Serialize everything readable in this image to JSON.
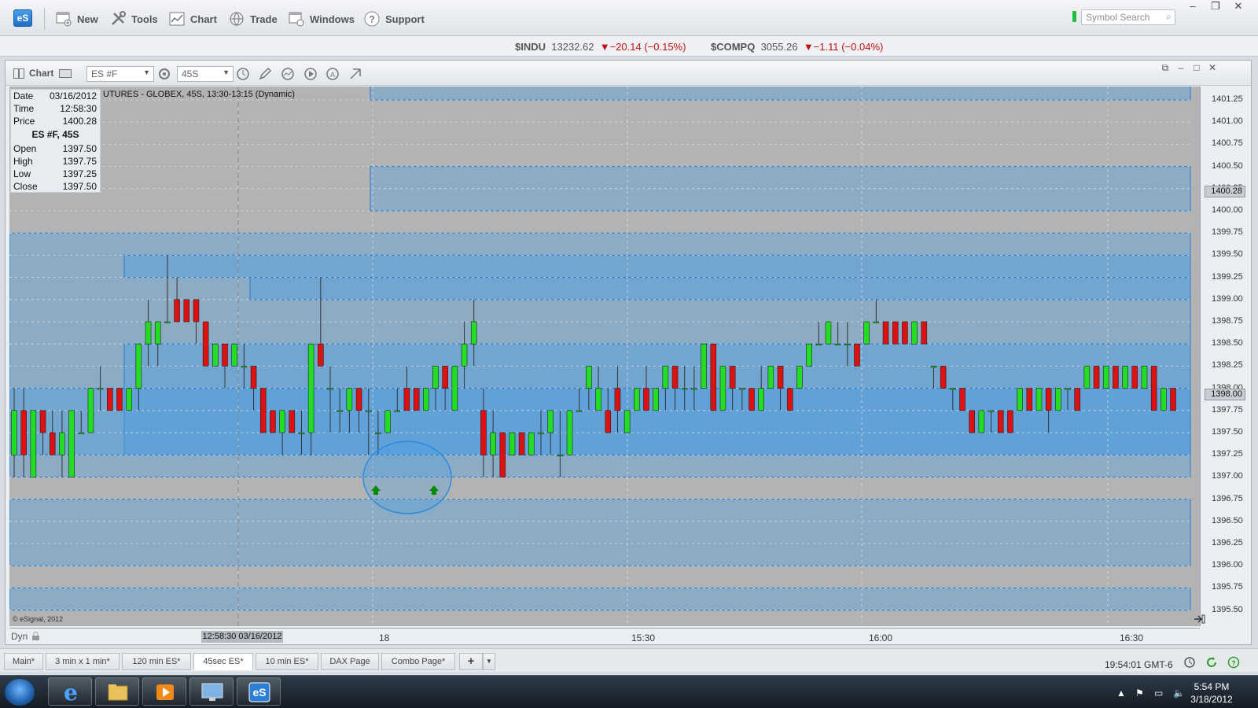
{
  "toolbar": {
    "logo": "eS",
    "buttons": [
      "New",
      "Tools",
      "Chart",
      "Trade",
      "Windows",
      "Support"
    ],
    "search_placeholder": "Symbol Search"
  },
  "tickers": [
    {
      "symbol": "$INDU",
      "last": "13232.62",
      "change": "▼−20.14 (−0.15%)"
    },
    {
      "symbol": "$COMPQ",
      "last": "3055.26",
      "change": "▼−1.11 (−0.04%)"
    }
  ],
  "chart_toolbar": {
    "title": "Chart",
    "symbol": "ES #F",
    "interval": "45S"
  },
  "info_box": {
    "date_label": "Date",
    "date": "03/16/2012",
    "time_label": "Time",
    "time": "12:58:30",
    "price_label": "Price",
    "price": "1400.28",
    "header": "ES #F, 45S",
    "open_label": "Open",
    "open": "1397.50",
    "high_label": "High",
    "high": "1397.75",
    "low_label": "Low",
    "low": "1397.25",
    "close_label": "Close",
    "close": "1397.50"
  },
  "chart_caption": "UTURES - GLOBEX, 45S, 13:30-13:15 (Dynamic)",
  "copyright": "© eSignal, 2012",
  "chart_data": {
    "type": "candlestick",
    "price_axis": [
      "1401.25",
      "1401.00",
      "1400.75",
      "1400.50",
      "1400.25",
      "1400.00",
      "1399.75",
      "1399.50",
      "1399.25",
      "1399.00",
      "1398.75",
      "1398.50",
      "1398.25",
      "1398.00",
      "1397.75",
      "1397.50",
      "1397.25",
      "1397.00",
      "1396.75",
      "1396.50",
      "1396.25",
      "1396.00",
      "1395.75",
      "1395.50"
    ],
    "ylim": [
      1395.5,
      1401.25
    ],
    "price_tags": [
      "1400.28",
      "1398.00"
    ],
    "time_axis": [
      "18",
      "15:30",
      "16:00",
      "16:30"
    ],
    "cursor_time": "12:58:30 03/16/2012",
    "colors": {
      "up": "#22dd22",
      "down": "#dd1111",
      "zone": "#3c9be8",
      "background": "#b3b3b3"
    }
  },
  "axis_footer": {
    "dyn": "Dyn"
  },
  "page_tabs": [
    "Main*",
    "3 min x 1 min*",
    "120 min ES*",
    "45sec ES*",
    "10 min ES*",
    "DAX Page",
    "Combo Page*",
    "+"
  ],
  "active_tab": "45sec ES*",
  "status_time": "19:54:01 GMT-6",
  "taskbar": {
    "time": "5:54 PM",
    "date": "3/18/2012"
  }
}
